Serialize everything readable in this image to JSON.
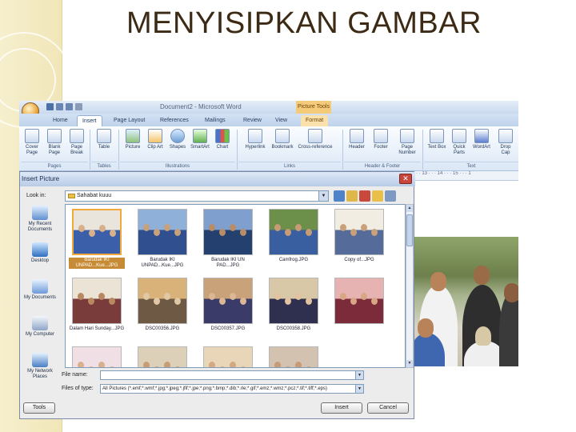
{
  "slide": {
    "title": "MENYISIPKAN GAMBAR"
  },
  "word": {
    "window_title": "Document2 - Microsoft Word",
    "picture_tools": "Picture Tools",
    "tabs": [
      "Home",
      "Insert",
      "Page Layout",
      "References",
      "Mailings",
      "Review",
      "View",
      "Format"
    ],
    "ribbon_buttons": [
      "Cover Page",
      "Blank Page",
      "Page Break",
      "Table",
      "Picture",
      "Clip Art",
      "Shapes",
      "SmartArt",
      "Chart",
      "Hyperlink",
      "Bookmark",
      "Cross-reference",
      "Header",
      "Footer",
      "Page Number",
      "Text Box",
      "Quick Parts",
      "WordArt",
      "Drop Cap"
    ],
    "groups": [
      "Pages",
      "Tables",
      "Illustrations",
      "Links",
      "Header & Footer",
      "Text"
    ],
    "ruler": "12 · · · 13 · · · 14 · · · 15 · · · 1"
  },
  "dialog": {
    "title": "Insert Picture",
    "look_in_label": "Look in:",
    "look_in_value": "Sahabat kuuu",
    "places": [
      "My Recent Documents",
      "Desktop",
      "My Documents",
      "My Computer",
      "My Network Places"
    ],
    "thumbnails": [
      {
        "label": "Barudak IKI UNPAD...Kue...JPG",
        "selected": true
      },
      {
        "label": "Barudak IKI UNPAD...Kue...JPG",
        "selected": false
      },
      {
        "label": "Barudak IKI UN PAD...JPG",
        "selected": false
      },
      {
        "label": "Camfrog.JPG",
        "selected": false
      },
      {
        "label": "Copy of...JPG",
        "selected": false
      },
      {
        "label": "Dalam Hari Sunday...JPG",
        "selected": false
      },
      {
        "label": "DSC00356.JPG",
        "selected": false
      },
      {
        "label": "DSC00357.JPG",
        "selected": false
      },
      {
        "label": "DSC00358.JPG",
        "selected": false
      },
      {
        "label": "",
        "selected": false
      },
      {
        "label": "",
        "selected": false
      },
      {
        "label": "",
        "selected": false
      },
      {
        "label": "",
        "selected": false
      },
      {
        "label": "",
        "selected": false
      }
    ],
    "file_name_label": "File name:",
    "file_name_value": "",
    "file_type_label": "Files of type:",
    "file_type_value": "All Pictures (*.emf;*.wmf;*.jpg;*.jpeg;*.jfif;*.jpe;*.png;*.bmp;*.dib;*.rle;*.gif;*.emz;*.wmz;*.pcz;*.tif;*.tiff;*.eps)",
    "tools_button": "Tools",
    "insert_button": "Insert",
    "cancel_button": "Cancel"
  },
  "colors": {
    "accent_bar": "#f1e6b8",
    "title_text": "#3d2a14",
    "selection": "#c78b36"
  }
}
